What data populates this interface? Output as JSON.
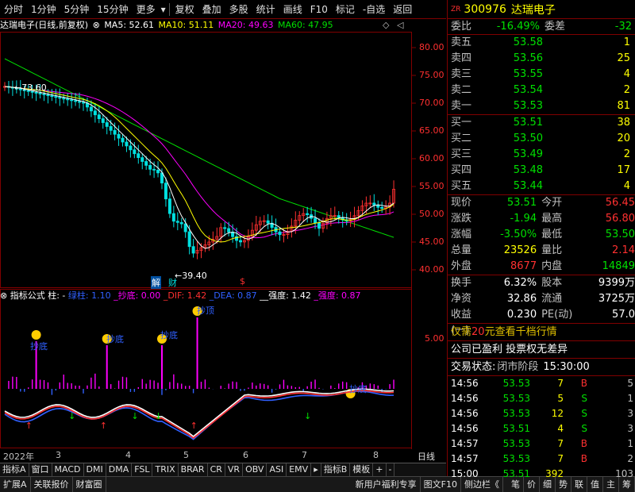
{
  "toolbar": {
    "items": [
      "分时",
      "1分钟",
      "5分钟",
      "15分钟",
      "更多",
      "复权",
      "叠加",
      "多股",
      "统计",
      "画线",
      "F10",
      "标记",
      "-自选",
      "返回"
    ]
  },
  "chart": {
    "stock_title": "达瑞电子(日线,前复权)",
    "ma5_label": "MA5: 52.61",
    "ma10_label": "MA10: 51.11",
    "ma20_label": "MA20: 49.63",
    "ma60_label": "MA60: 47.95",
    "high_mark": "73.60",
    "low_mark": "39.40",
    "signal_1": "解",
    "signal_2": "财",
    "signal_3": "$",
    "colors": {
      "up": "#ff3030",
      "down": "#00e0e0",
      "ma5": "#ffffff",
      "ma10": "#ffff00",
      "ma20": "#ff00ff",
      "ma60": "#00e000",
      "axis": "#800000"
    }
  },
  "indicator": {
    "title": "指标公式 柱:",
    "value_dash": "-",
    "green_col": "绿柱: 1.10",
    "bottom": "_抄底: 0.00",
    "dif": "_DIF: 1.42",
    "dea": "_DEA: 0.87",
    "strength1": "__强度: 1.42",
    "strength2": "_强度: 0.87",
    "y_tick": "5.00",
    "tag_bottom": "抄底",
    "tag_top": "抄顶"
  },
  "x_axis": {
    "labels": [
      "2022年",
      "3",
      "4",
      "5",
      "6",
      "7",
      "8"
    ],
    "right_label": "日线"
  },
  "y_axis": {
    "ticks": [
      "80.00",
      "75.00",
      "70.00",
      "65.00",
      "60.00",
      "55.00",
      "50.00",
      "45.00",
      "40.00"
    ]
  },
  "tabs": [
    "指标A",
    "窗口",
    "MACD",
    "DMI",
    "DMA",
    "FSL",
    "TRIX",
    "BRAR",
    "CR",
    "VR",
    "OBV",
    "ASI",
    "EMV",
    "指标B",
    "模板",
    "+",
    "-"
  ],
  "bottom_bar": [
    "扩展A",
    "关联报价",
    "财富圈"
  ],
  "bottom_bar_mid": [
    "新用户福利专享",
    "图文F10",
    "侧边栏《"
  ],
  "bottom_bar_right": [
    "笔",
    "价",
    "细",
    "势",
    "联",
    "值",
    "主",
    "筹"
  ],
  "quote": {
    "zr": "ZR",
    "code": "300976",
    "name": "达瑞电子",
    "weibi_label": "委比",
    "weibi": "-16.49%",
    "weicha_label": "委差",
    "weicha": "-32",
    "asks": [
      {
        "label": "卖五",
        "price": "53.58",
        "vol": "1"
      },
      {
        "label": "卖四",
        "price": "53.56",
        "vol": "25"
      },
      {
        "label": "卖三",
        "price": "53.55",
        "vol": "4"
      },
      {
        "label": "卖二",
        "price": "53.54",
        "vol": "2"
      },
      {
        "label": "卖一",
        "price": "53.53",
        "vol": "81"
      }
    ],
    "bids": [
      {
        "label": "买一",
        "price": "53.51",
        "vol": "38"
      },
      {
        "label": "买二",
        "price": "53.50",
        "vol": "20"
      },
      {
        "label": "买三",
        "price": "53.49",
        "vol": "2"
      },
      {
        "label": "买四",
        "price": "53.48",
        "vol": "17"
      },
      {
        "label": "买五",
        "price": "53.44",
        "vol": "4"
      }
    ],
    "stats": [
      {
        "l1": "现价",
        "v1": "53.51",
        "c1": "green",
        "l2": "今开",
        "v2": "56.45",
        "c2": "red"
      },
      {
        "l1": "涨跌",
        "v1": "-1.94",
        "c1": "green",
        "l2": "最高",
        "v2": "56.80",
        "c2": "red"
      },
      {
        "l1": "涨幅",
        "v1": "-3.50%",
        "c1": "green",
        "l2": "最低",
        "v2": "53.50",
        "c2": "green"
      },
      {
        "l1": "总量",
        "v1": "23526",
        "c1": "yellow",
        "l2": "量比",
        "v2": "2.14",
        "c2": "red"
      },
      {
        "l1": "外盘",
        "v1": "8677",
        "c1": "red",
        "l2": "内盘",
        "v2": "14849",
        "c2": "green"
      }
    ],
    "stats2": [
      {
        "l1": "换手",
        "v1": "6.32%",
        "l2": "股本",
        "v2": "9399万"
      },
      {
        "l1": "净资",
        "v1": "32.86",
        "l2": "流通",
        "v2": "3725万"
      },
      {
        "l1": "收益(一)",
        "v1": "0.230",
        "l2": "PE(动)",
        "v2": "57.0"
      }
    ],
    "promo_pre": "仅需",
    "promo_num": "20",
    "promo_post": "元查看千档行情",
    "notice": "公司已盈利 投票权无差异",
    "status_label": "交易状态:",
    "status_value": "闭市阶段",
    "status_time": "15:30:00",
    "ticks": [
      {
        "t": "14:56",
        "p": "53.53",
        "v": "7",
        "bs": "B",
        "n": "5"
      },
      {
        "t": "14:56",
        "p": "53.53",
        "v": "5",
        "bs": "S",
        "n": "1"
      },
      {
        "t": "14:56",
        "p": "53.53",
        "v": "12",
        "bs": "S",
        "n": "3"
      },
      {
        "t": "14:56",
        "p": "53.51",
        "v": "4",
        "bs": "S",
        "n": "3"
      },
      {
        "t": "14:57",
        "p": "53.53",
        "v": "7",
        "bs": "B",
        "n": "1"
      },
      {
        "t": "14:57",
        "p": "53.53",
        "v": "7",
        "bs": "B",
        "n": "2"
      },
      {
        "t": "15:00",
        "p": "53.51",
        "v": "392",
        "bs": "",
        "n": "103"
      }
    ]
  }
}
